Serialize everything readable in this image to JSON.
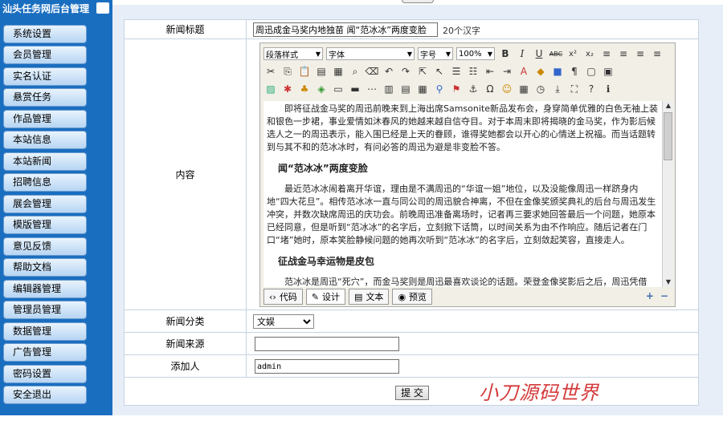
{
  "sidebar": {
    "title": "汕头任务网后台管理",
    "items": [
      {
        "label": "系统设置"
      },
      {
        "label": "会员管理"
      },
      {
        "label": "实名认证"
      },
      {
        "label": "悬赏任务"
      },
      {
        "label": "作品管理"
      },
      {
        "label": "本站信息"
      },
      {
        "label": "本站新闻"
      },
      {
        "label": "招聘信息"
      },
      {
        "label": "展会管理"
      },
      {
        "label": "模版管理"
      },
      {
        "label": "意见反馈"
      },
      {
        "label": "帮助文档"
      },
      {
        "label": "编辑器管理"
      },
      {
        "label": "管理员管理"
      },
      {
        "label": "数据管理"
      },
      {
        "label": "广告管理"
      },
      {
        "label": "密码设置"
      },
      {
        "label": "安全退出"
      }
    ]
  },
  "form": {
    "title_label": "新闻标题",
    "title_value": "周迅成金马奖内地独苗 闻“范冰冰”两度变脸",
    "title_hint": "20个汉字",
    "content_label": "内容",
    "category_label": "新闻分类",
    "category_value": "文娱",
    "source_label": "新闻来源",
    "source_value": "",
    "author_label": "添加人",
    "author_value": "admin",
    "submit_label": "提 交"
  },
  "editor": {
    "paragraph_select": "段落样式",
    "font_select": "字体",
    "size_select": "字号",
    "zoom_select": "100%",
    "toolbar_row1": [
      "B",
      "I",
      "U",
      "ABC",
      "x²",
      "x₂",
      "≡",
      "≡",
      "≡",
      "≡"
    ],
    "toolbar_row2_icons": [
      "cut-icon",
      "copy-icon",
      "paste-icon",
      "paste-text-icon",
      "paste-word-icon",
      "find-icon",
      "eraser-icon",
      "undo-icon",
      "redo-icon",
      "select-icon",
      "pointer-icon",
      "ordered-list-icon",
      "unordered-list-icon",
      "outdent-icon",
      "indent-icon",
      "font-color-icon",
      "highlight-icon",
      "bgcolor-icon",
      "format-icon",
      "box-icon",
      "frame-icon"
    ],
    "toolbar_row3_icons": [
      "image-icon",
      "flash-icon",
      "media-icon",
      "file-icon",
      "table-icon",
      "hr-icon",
      "marquee-icon",
      "form-icon",
      "input-icon",
      "button-icon",
      "link-icon",
      "unlink-icon",
      "anchor-icon",
      "special-char-icon",
      "emoji-icon",
      "date-icon",
      "time-icon",
      "page-break-icon",
      "fullscreen-icon",
      "help-icon",
      "about-icon"
    ],
    "content": {
      "p1": "即将征战金马奖的周迅前晚来到上海出席Samsonite新品发布会，身穿简单优雅的白色无袖上装和银色一步裙，事业爱情如沐春风的她越来越自信夺目。对于本周末即将揭晓的金马奖，作为影后候选人之一的周迅表示，能入围已经是上天的眷顾，谁得奖她都会以开心的心情送上祝福。而当话题转到与其不和的范冰冰时，有问必答的周迅为避是非变脸不答。",
      "h1": "闻“范冰冰”两度变脸",
      "p2": "最近范冰冰闹着离开华谊，理由是不满周迅的“华谊一姐”地位，以及没能像周迅一样跻身内地“四大花旦”。相传范冰冰一直与同公司的周迅貌合神离，不但在金像奖颁奖典礼的后台与周迅发生冲突，并数次缺席周迅的庆功会。前晚周迅准备离场时，记者再三要求她回答最后一个问题，她原本已经同意，但是听到“范冰冰”的名字后，立刻掀下话筒，以时间关系为由不作响应。随后记者在门口“堵”她时，原本笑脸静候问题的她再次听到“范冰冰”的名字后，立刻敛起笑容，直接走人。",
      "h2": "征战金马幸运物是皮包",
      "p3": "范冰冰是周迅“死穴”，而金马奖则是周迅最喜欢谈论的话题。荣登金像奖影后之后，周迅凭借"
    },
    "modes": [
      {
        "icon": "‹›",
        "label": "代码"
      },
      {
        "icon": "✎",
        "label": "设计"
      },
      {
        "icon": "▤",
        "label": "文本"
      },
      {
        "icon": "◉",
        "label": "预览"
      }
    ],
    "zoom_in": "+",
    "zoom_out": "−"
  },
  "watermark": "小刀源码世界",
  "colors": {
    "sidebar": "#1a6ec0",
    "main_bg": "#e7eef7",
    "watermark": "#d43a3a"
  }
}
